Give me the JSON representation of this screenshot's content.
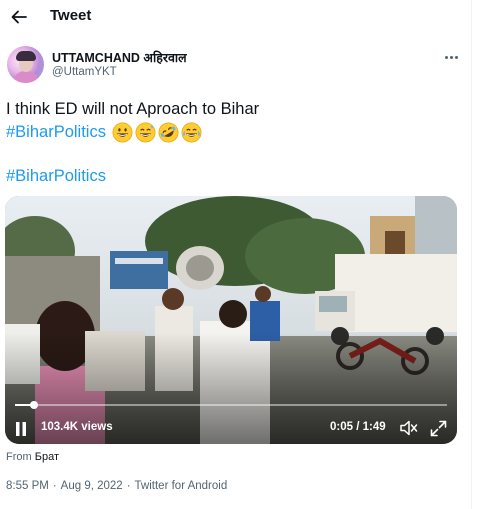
{
  "header": {
    "title": "Tweet"
  },
  "author": {
    "display_name": "UTTAMCHAND अहिरवाल",
    "handle": "@UttamYKT"
  },
  "tweet": {
    "line1": "I think ED will not Aproach to Bihar",
    "hashtag1": "#BiharPolitics",
    "emojis": [
      "grinning-face",
      "grinning-sweat-face",
      "rolling-laughing-face",
      "tears-of-joy-face"
    ],
    "hashtag2": "#BiharPolitics"
  },
  "video": {
    "views": "103.4K views",
    "time": "0:05 / 1:49",
    "progress_fraction": 0.045,
    "icons": [
      "pause-icon",
      "mute-icon",
      "fullscreen-icon"
    ]
  },
  "source": {
    "prefix": "From",
    "name": "Брат"
  },
  "meta": {
    "time": "8:55 PM",
    "date": "Aug 9, 2022",
    "separator": "·",
    "client": "Twitter for Android"
  },
  "colors": {
    "accent": "#1d9bf0",
    "text": "#0f1419",
    "secondary": "#536471"
  }
}
